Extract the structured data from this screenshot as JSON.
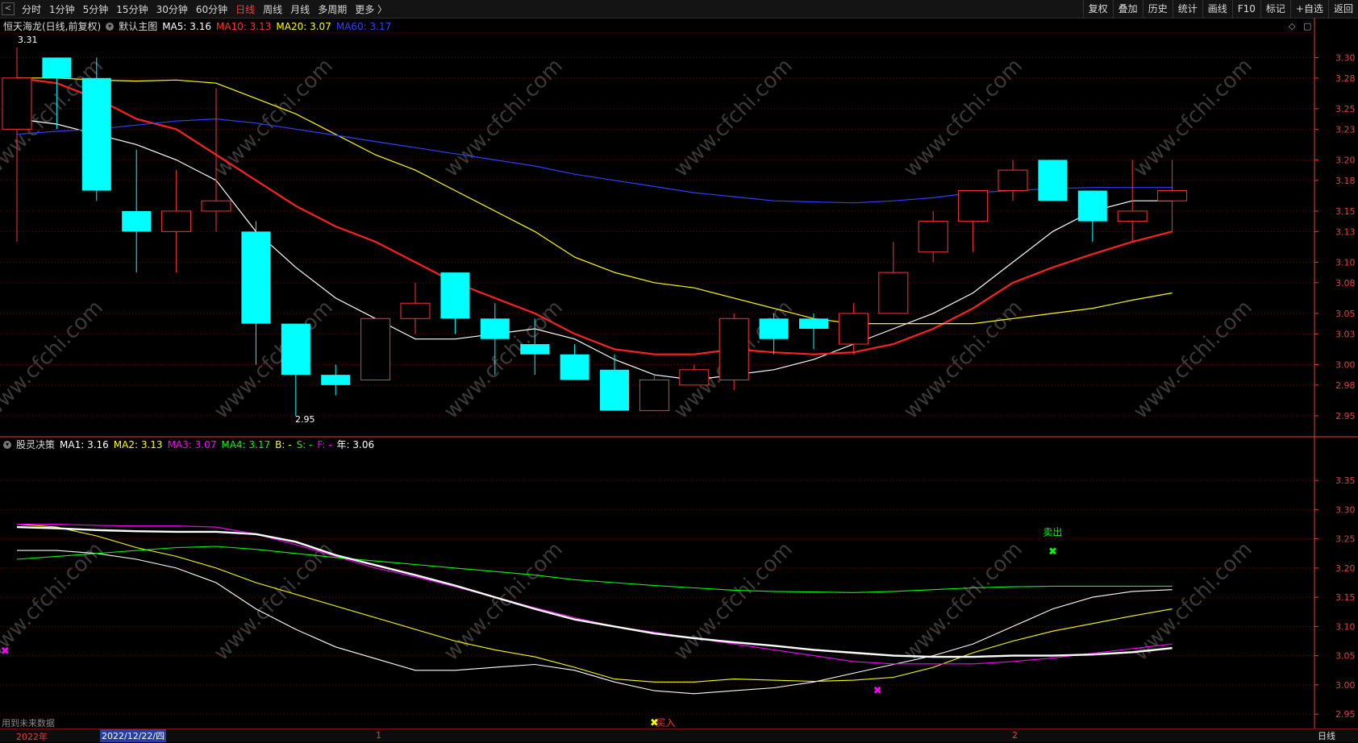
{
  "toolbar": {
    "nav_left": "<",
    "periods": [
      "分时",
      "1分钟",
      "5分钟",
      "15分钟",
      "30分钟",
      "60分钟",
      "日线",
      "周线",
      "月线",
      "多周期",
      "更多 〉"
    ],
    "active_period": "日线",
    "right_buttons": [
      "复权",
      "叠加",
      "历史",
      "统计",
      "画线",
      "F10",
      "标记",
      "+自选",
      "返回"
    ]
  },
  "main_legend": {
    "stock": "恒天海龙(日线,前复权)",
    "template": "默认主图",
    "ma5": "MA5: 3.16",
    "ma10": "MA10: 3.13",
    "ma20": "MA20: 3.07",
    "ma60": "MA60: 3.17"
  },
  "main_annotations": {
    "high": "3.31",
    "low": "2.95"
  },
  "ind_legend": {
    "name": "股灵决策",
    "ma1": "MA1: 3.16",
    "ma2": "MA2: 3.13",
    "ma3": "MA3: 3.07",
    "ma4": "MA4: 3.17",
    "b": "B: -",
    "s": "S: -",
    "f": "F: -",
    "year": "年: 3.06"
  },
  "ind_annotations": {
    "sell": "卖出",
    "buy": "买入"
  },
  "status_bar": {
    "year_label": "2022年",
    "cursor_date": "2022/12/22/四",
    "tick_1": "1",
    "tick_2": "2",
    "period": "日线",
    "future_note": "用到未来数据"
  },
  "watermark": "www.cfchi.com",
  "colors": {
    "up": "#ff3232",
    "down": "#00ffff",
    "ma5": "#ffffff",
    "ma10": "#ff2020",
    "ma20": "#ffff00",
    "ma60": "#3040ff",
    "green": "#00ff00",
    "magenta": "#ff00ff",
    "axis": "#e04040"
  },
  "chart_data": [
    {
      "type": "candlestick",
      "title": "恒天海龙(日线,前复权)",
      "ylim": [
        2.935,
        3.32
      ],
      "yticks": [
        "2.95",
        "2.98",
        "3.00",
        "3.03",
        "3.05",
        "3.08",
        "3.10",
        "3.13",
        "3.15",
        "3.18",
        "3.20",
        "3.23",
        "3.25",
        "3.28",
        "3.30"
      ],
      "candles": [
        {
          "o": 3.23,
          "h": 3.31,
          "l": 3.12,
          "c": 3.28,
          "d": "up"
        },
        {
          "o": 3.28,
          "h": 3.3,
          "l": 3.23,
          "c": 3.3,
          "d": "down"
        },
        {
          "o": 3.28,
          "h": 3.3,
          "l": 3.16,
          "c": 3.17,
          "d": "down"
        },
        {
          "o": 3.15,
          "h": 3.21,
          "l": 3.09,
          "c": 3.13,
          "d": "down"
        },
        {
          "o": 3.13,
          "h": 3.19,
          "l": 3.09,
          "c": 3.15,
          "d": "up"
        },
        {
          "o": 3.15,
          "h": 3.27,
          "l": 3.13,
          "c": 3.16,
          "d": "up"
        },
        {
          "o": 3.13,
          "h": 3.14,
          "l": 3.0,
          "c": 3.04,
          "d": "down"
        },
        {
          "o": 3.04,
          "h": 3.04,
          "l": 2.95,
          "c": 2.99,
          "d": "down"
        },
        {
          "o": 2.99,
          "h": 3.0,
          "l": 2.97,
          "c": 2.98,
          "d": "down"
        },
        {
          "o": 2.985,
          "h": 3.045,
          "l": 2.985,
          "c": 3.045,
          "d": "up"
        },
        {
          "o": 3.045,
          "h": 3.08,
          "l": 3.03,
          "c": 3.06,
          "d": "up"
        },
        {
          "o": 3.09,
          "h": 3.09,
          "l": 3.03,
          "c": 3.045,
          "d": "down"
        },
        {
          "o": 3.045,
          "h": 3.06,
          "l": 2.99,
          "c": 3.025,
          "d": "down"
        },
        {
          "o": 3.02,
          "h": 3.045,
          "l": 2.99,
          "c": 3.01,
          "d": "down"
        },
        {
          "o": 3.01,
          "h": 3.02,
          "l": 2.985,
          "c": 2.985,
          "d": "down"
        },
        {
          "o": 2.995,
          "h": 3.01,
          "l": 2.955,
          "c": 2.955,
          "d": "down"
        },
        {
          "o": 2.955,
          "h": 2.99,
          "l": 2.955,
          "c": 2.985,
          "d": "up"
        },
        {
          "o": 2.98,
          "h": 3.0,
          "l": 2.98,
          "c": 2.995,
          "d": "up"
        },
        {
          "o": 2.985,
          "h": 3.05,
          "l": 2.975,
          "c": 3.045,
          "d": "up"
        },
        {
          "o": 3.045,
          "h": 3.05,
          "l": 3.01,
          "c": 3.025,
          "d": "down"
        },
        {
          "o": 3.045,
          "h": 3.05,
          "l": 3.015,
          "c": 3.035,
          "d": "down"
        },
        {
          "o": 3.02,
          "h": 3.06,
          "l": 3.01,
          "c": 3.05,
          "d": "up"
        },
        {
          "o": 3.05,
          "h": 3.12,
          "l": 3.05,
          "c": 3.09,
          "d": "up"
        },
        {
          "o": 3.11,
          "h": 3.15,
          "l": 3.1,
          "c": 3.14,
          "d": "up"
        },
        {
          "o": 3.14,
          "h": 3.17,
          "l": 3.11,
          "c": 3.17,
          "d": "up"
        },
        {
          "o": 3.17,
          "h": 3.2,
          "l": 3.16,
          "c": 3.19,
          "d": "up"
        },
        {
          "o": 3.2,
          "h": 3.2,
          "l": 3.16,
          "c": 3.16,
          "d": "down"
        },
        {
          "o": 3.17,
          "h": 3.17,
          "l": 3.12,
          "c": 3.14,
          "d": "down"
        },
        {
          "o": 3.14,
          "h": 3.2,
          "l": 3.12,
          "c": 3.15,
          "d": "up"
        },
        {
          "o": 3.16,
          "h": 3.2,
          "l": 3.13,
          "c": 3.17,
          "d": "up"
        }
      ],
      "series": [
        {
          "name": "MA5",
          "color": "#ffffff",
          "values": [
            3.24,
            3.235,
            3.225,
            3.215,
            3.2,
            3.18,
            3.13,
            3.095,
            3.065,
            3.045,
            3.025,
            3.025,
            3.03,
            3.035,
            3.025,
            3.005,
            2.99,
            2.985,
            2.99,
            2.995,
            3.005,
            3.02,
            3.035,
            3.05,
            3.07,
            3.1,
            3.13,
            3.15,
            3.16,
            3.16
          ]
        },
        {
          "name": "MA10",
          "color": "#ff2020",
          "values": [
            3.28,
            3.275,
            3.26,
            3.24,
            3.23,
            3.205,
            3.18,
            3.155,
            3.135,
            3.12,
            3.1,
            3.08,
            3.065,
            3.05,
            3.03,
            3.015,
            3.01,
            3.01,
            3.015,
            3.012,
            3.01,
            3.012,
            3.02,
            3.035,
            3.055,
            3.08,
            3.095,
            3.108,
            3.12,
            3.13
          ]
        },
        {
          "name": "MA20",
          "color": "#ffff00",
          "values": [
            3.28,
            3.28,
            3.278,
            3.277,
            3.278,
            3.275,
            3.26,
            3.245,
            3.225,
            3.205,
            3.19,
            3.17,
            3.15,
            3.13,
            3.105,
            3.09,
            3.08,
            3.075,
            3.065,
            3.055,
            3.045,
            3.04,
            3.04,
            3.04,
            3.04,
            3.045,
            3.05,
            3.055,
            3.063,
            3.07
          ]
        },
        {
          "name": "MA60",
          "color": "#3040ff",
          "values": [
            3.225,
            3.228,
            3.23,
            3.234,
            3.238,
            3.24,
            3.236,
            3.23,
            3.224,
            3.218,
            3.212,
            3.206,
            3.2,
            3.194,
            3.186,
            3.18,
            3.174,
            3.168,
            3.164,
            3.16,
            3.159,
            3.158,
            3.16,
            3.163,
            3.168,
            3.17,
            3.172,
            3.173,
            3.173,
            3.173
          ]
        }
      ]
    },
    {
      "type": "line",
      "title": "股灵决策",
      "ylim": [
        2.935,
        3.375
      ],
      "yticks": [
        "2.95",
        "3.00",
        "3.05",
        "3.10",
        "3.15",
        "3.20",
        "3.25",
        "3.30",
        "3.35"
      ],
      "series": [
        {
          "name": "MA1",
          "color": "#ffffff",
          "values": [
            3.23,
            3.23,
            3.225,
            3.215,
            3.2,
            3.175,
            3.13,
            3.095,
            3.065,
            3.045,
            3.025,
            3.025,
            3.03,
            3.035,
            3.025,
            3.005,
            2.99,
            2.985,
            2.99,
            2.995,
            3.005,
            3.02,
            3.035,
            3.05,
            3.07,
            3.1,
            3.13,
            3.15,
            3.16,
            3.163
          ]
        },
        {
          "name": "MA2",
          "color": "#ffff00",
          "values": [
            3.275,
            3.27,
            3.255,
            3.235,
            3.22,
            3.2,
            3.175,
            3.155,
            3.135,
            3.115,
            3.095,
            3.075,
            3.06,
            3.048,
            3.03,
            3.01,
            3.005,
            3.005,
            3.01,
            3.008,
            3.006,
            3.008,
            3.013,
            3.03,
            3.055,
            3.075,
            3.092,
            3.105,
            3.118,
            3.13
          ]
        },
        {
          "name": "MA3",
          "color": "#ff00ff",
          "values": [
            3.275,
            3.275,
            3.273,
            3.272,
            3.272,
            3.27,
            3.258,
            3.24,
            3.22,
            3.2,
            3.185,
            3.168,
            3.15,
            3.132,
            3.115,
            3.1,
            3.09,
            3.08,
            3.07,
            3.06,
            3.05,
            3.04,
            3.036,
            3.036,
            3.036,
            3.04,
            3.046,
            3.054,
            3.062,
            3.07
          ]
        },
        {
          "name": "MA4",
          "color": "#00ff00",
          "values": [
            3.215,
            3.22,
            3.225,
            3.23,
            3.235,
            3.237,
            3.232,
            3.225,
            3.218,
            3.212,
            3.206,
            3.2,
            3.194,
            3.188,
            3.18,
            3.175,
            3.17,
            3.166,
            3.162,
            3.16,
            3.159,
            3.158,
            3.16,
            3.163,
            3.166,
            3.168,
            3.169,
            3.169,
            3.169,
            3.169
          ]
        },
        {
          "name": "年",
          "color": "#ffffff",
          "values": [
            3.27,
            3.268,
            3.265,
            3.263,
            3.262,
            3.262,
            3.258,
            3.245,
            3.222,
            3.205,
            3.188,
            3.17,
            3.15,
            3.13,
            3.112,
            3.1,
            3.088,
            3.08,
            3.073,
            3.067,
            3.06,
            3.055,
            3.05,
            3.048,
            3.048,
            3.05,
            3.05,
            3.052,
            3.056,
            3.063
          ]
        }
      ],
      "markers": [
        {
          "i": -0.3,
          "v": 3.058,
          "color": "#ff00ff",
          "label": ""
        },
        {
          "i": 16,
          "v": 2.935,
          "color": "#ffff00",
          "label": "买入"
        },
        {
          "i": 21.6,
          "v": 2.99,
          "color": "#ff00ff",
          "label": ""
        },
        {
          "i": 26,
          "v": 3.228,
          "color": "#00ff00",
          "label": "卖出"
        }
      ]
    }
  ]
}
